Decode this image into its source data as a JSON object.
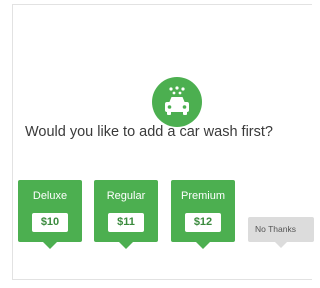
{
  "prompt": {
    "text": "Would you like to add a car wash first?"
  },
  "icon": {
    "name": "car-wash-icon",
    "color": "#4caf50"
  },
  "options": [
    {
      "name": "Deluxe",
      "price": "$10"
    },
    {
      "name": "Regular",
      "price": "$11"
    },
    {
      "name": "Premium",
      "price": "$12"
    }
  ],
  "decline": {
    "label": "No Thanks"
  },
  "colors": {
    "accent": "#4caf50",
    "decline_bg": "#dcdcdc",
    "text": "#3a3a3a"
  }
}
